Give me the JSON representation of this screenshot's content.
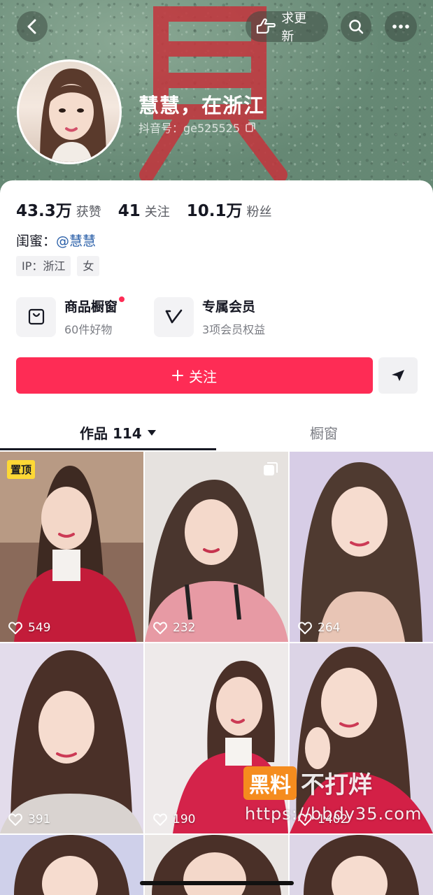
{
  "header": {
    "update_label": "求更新",
    "nickname": "慧慧，在浙江",
    "douyin_id": "抖音号：ge525525"
  },
  "stats": [
    {
      "value": "43.3万",
      "label": "获赞"
    },
    {
      "value": "41",
      "label": "关注"
    },
    {
      "value": "10.1万",
      "label": "粉丝"
    }
  ],
  "bestie": {
    "label": "闺蜜：",
    "mention": "@慧慧"
  },
  "tags": [
    "IP：浙江",
    "女"
  ],
  "features": {
    "shop": {
      "title": "商品橱窗",
      "subtitle": "60件好物"
    },
    "member": {
      "title": "专属会员",
      "subtitle": "3项会员权益"
    }
  },
  "actions": {
    "follow_label": "关注"
  },
  "tabs": {
    "works_label": "作品 114",
    "shop_label": "橱窗"
  },
  "videos": [
    {
      "likes": "549",
      "pinned_label": "置顶"
    },
    {
      "likes": "232"
    },
    {
      "likes": "264"
    },
    {
      "likes": "391"
    },
    {
      "likes": "190"
    },
    {
      "likes": "1402"
    }
  ],
  "watermark": {
    "brand": "黑料",
    "text": "不打烊",
    "url": "https://bbdy35.com"
  },
  "colors": {
    "accent": "#fe2c55",
    "mention": "#2a5fa8",
    "pin": "#fdd835"
  }
}
